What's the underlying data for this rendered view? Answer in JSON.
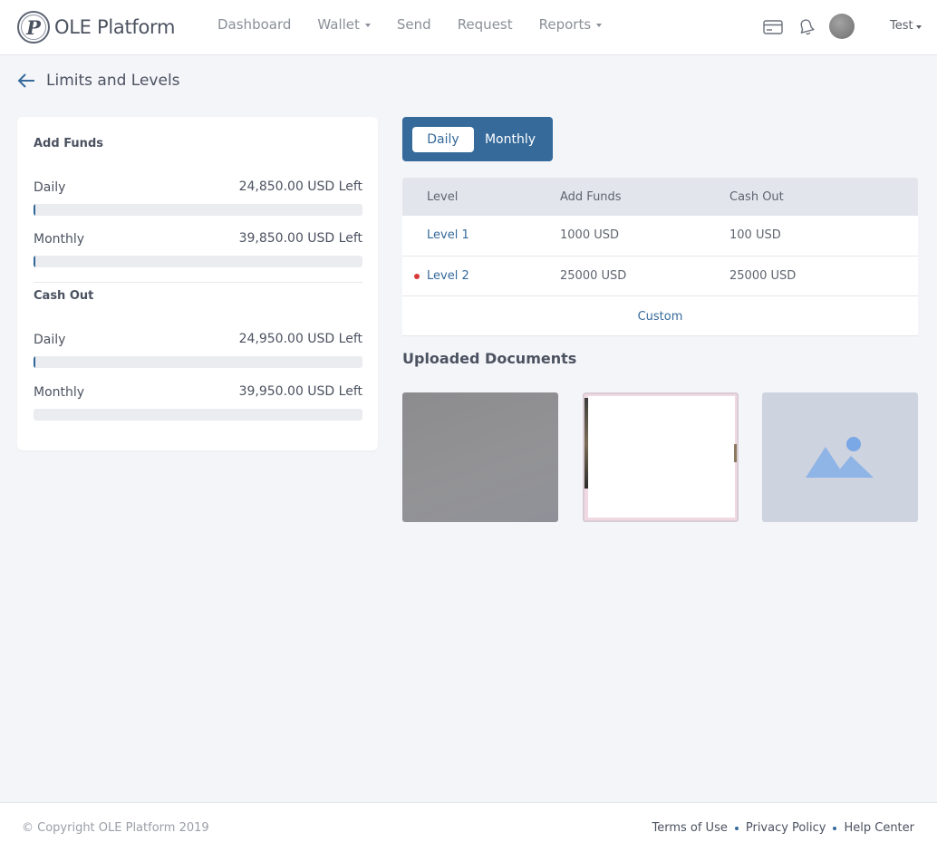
{
  "app": {
    "logo_letter": "P",
    "name": "OLE Platform"
  },
  "nav": {
    "items": [
      {
        "label": "Dashboard",
        "dropdown": false
      },
      {
        "label": "Wallet",
        "dropdown": true
      },
      {
        "label": "Send",
        "dropdown": false
      },
      {
        "label": "Request",
        "dropdown": false
      },
      {
        "label": "Reports",
        "dropdown": true
      }
    ]
  },
  "header": {
    "icons": [
      "card-icon",
      "bell-icon"
    ],
    "user_name": "Test"
  },
  "page": {
    "title": "Limits and Levels"
  },
  "limits": {
    "add_funds": {
      "title": "Add Funds",
      "daily": {
        "label": "Daily",
        "value": "24,850.00 USD Left",
        "used_fraction": 0.006
      },
      "monthly": {
        "label": "Monthly",
        "value": "39,850.00 USD Left",
        "used_fraction": 0.004
      }
    },
    "cash_out": {
      "title": "Cash Out",
      "daily": {
        "label": "Daily",
        "value": "24,950.00 USD Left",
        "used_fraction": 0.004
      },
      "monthly": {
        "label": "Monthly",
        "value": "39,950.00 USD Left",
        "used_fraction": 0.0
      }
    }
  },
  "period_toggle": {
    "options": [
      "Daily",
      "Monthly"
    ],
    "selected": "Daily"
  },
  "levels_table": {
    "headers": [
      "Level",
      "Add Funds",
      "Cash Out"
    ],
    "rows": [
      {
        "level": "Level 1",
        "add_funds": "1000 USD",
        "cash_out": "100 USD",
        "current": false
      },
      {
        "level": "Level 2",
        "add_funds": "25000 USD",
        "cash_out": "25000 USD",
        "current": true
      }
    ],
    "custom_label": "Custom"
  },
  "documents": {
    "title": "Uploaded Documents",
    "items": [
      "document-thumbnail",
      "document-thumbnail",
      "image-placeholder-icon"
    ]
  },
  "footer": {
    "copyright": "© Copyright OLE Platform 2019",
    "links": [
      "Terms of Use",
      "Privacy Policy",
      "Help Center"
    ]
  },
  "colors": {
    "brand": "#356a9b",
    "background": "#f4f5f9",
    "current_level_dot": "#d83a3a",
    "placeholder_icon": "#8fb4e6"
  }
}
